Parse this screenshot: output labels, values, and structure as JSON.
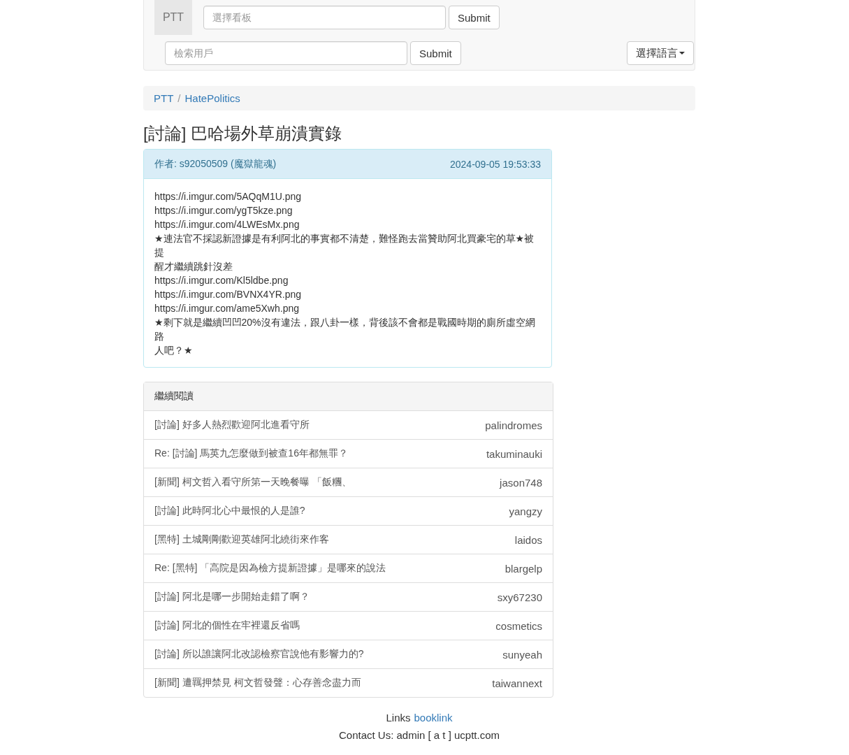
{
  "navbar": {
    "brand": "PTT",
    "board_search": {
      "placeholder": "選擇看板",
      "button": "Submit"
    },
    "user_search": {
      "placeholder": "檢索用戶",
      "button": "Submit"
    },
    "language_menu": "選擇語言"
  },
  "breadcrumb": {
    "items": [
      "PTT",
      "HatePolitics"
    ],
    "separator": "/"
  },
  "post": {
    "title": "[討論] 巴哈場外草崩潰實錄",
    "author": "作者: s92050509 (魔獄龍魂)",
    "time": "2024-09-05 19:53:33",
    "lines": [
      "https://i.imgur.com/5AQqM1U.png",
      "https://i.imgur.com/ygT5kze.png",
      "https://i.imgur.com/4LWEsMx.png",
      "★連法官不採認新證據是有利阿北的事實都不清楚，難怪跑去當贊助阿北買豪宅的草★被提",
      "醒才繼續跳針沒差",
      "https://i.imgur.com/Kl5ldbe.png",
      "https://i.imgur.com/BVNX4YR.png",
      "https://i.imgur.com/ame5Xwh.png",
      "★剩下就是繼續凹凹20%沒有違法，跟八卦一樣，背後該不會都是戰國時期的廁所虛空網路",
      "人吧？★"
    ]
  },
  "related": {
    "heading": "繼續閱讀",
    "items": [
      {
        "title": "[討論] 好多人熱烈歡迎阿北進看守所",
        "author": "palindromes"
      },
      {
        "title": "Re: [討論] 馬英九怎麼做到被查16年都無罪？",
        "author": "takuminauki"
      },
      {
        "title": "[新聞] 柯文哲入看守所第一天晚餐曝 「飯糰、",
        "author": "jason748"
      },
      {
        "title": "[討論] 此時阿北心中最恨的人是誰?",
        "author": "yangzy"
      },
      {
        "title": "[黑特] 土城剛剛歡迎英雄阿北繞街來作客",
        "author": "laidos"
      },
      {
        "title": "Re: [黑特] 「高院是因為檢方提新證據」是哪來的說法",
        "author": "blargelp"
      },
      {
        "title": "[討論] 阿北是哪一步開始走錯了啊？",
        "author": "sxy67230"
      },
      {
        "title": "[討論] 阿北的個性在牢裡還反省嗎",
        "author": "cosmetics"
      },
      {
        "title": "[討論] 所以誰讓阿北改認檢察官說他有影響力的?",
        "author": "sunyeah"
      },
      {
        "title": "[新聞] 遭羈押禁見 柯文哲發聲：心存善念盡力而",
        "author": "taiwannext"
      }
    ]
  },
  "footer": {
    "links_label": "Links",
    "link": "booklink",
    "contact": "Contact Us: admin [ a t ] ucptt.com"
  }
}
